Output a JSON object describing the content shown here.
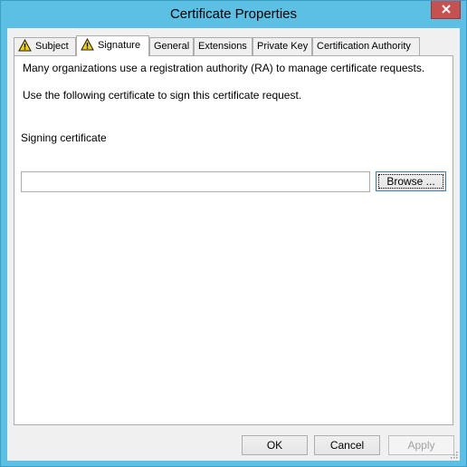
{
  "window": {
    "title": "Certificate Properties"
  },
  "tabs": [
    {
      "label": "Subject",
      "warning": true
    },
    {
      "label": "Signature",
      "warning": true,
      "active": true
    },
    {
      "label": "General"
    },
    {
      "label": "Extensions"
    },
    {
      "label": "Private Key"
    },
    {
      "label": "Certification Authority"
    }
  ],
  "panel": {
    "intro": "Many organizations use a registration authority (RA) to manage certificate requests.",
    "instruction": "Use the following certificate to sign this certificate request.",
    "signing_label": "Signing certificate",
    "signing_value": "",
    "browse_label": "Browse ..."
  },
  "footer": {
    "ok_label": "OK",
    "cancel_label": "Cancel",
    "apply_label": "Apply"
  },
  "icons": {
    "warning": "warning-icon",
    "close": "close-icon"
  },
  "colors": {
    "titlebar": "#5bc0e4",
    "close_button": "#c75050",
    "warning": "#f5d10b"
  }
}
